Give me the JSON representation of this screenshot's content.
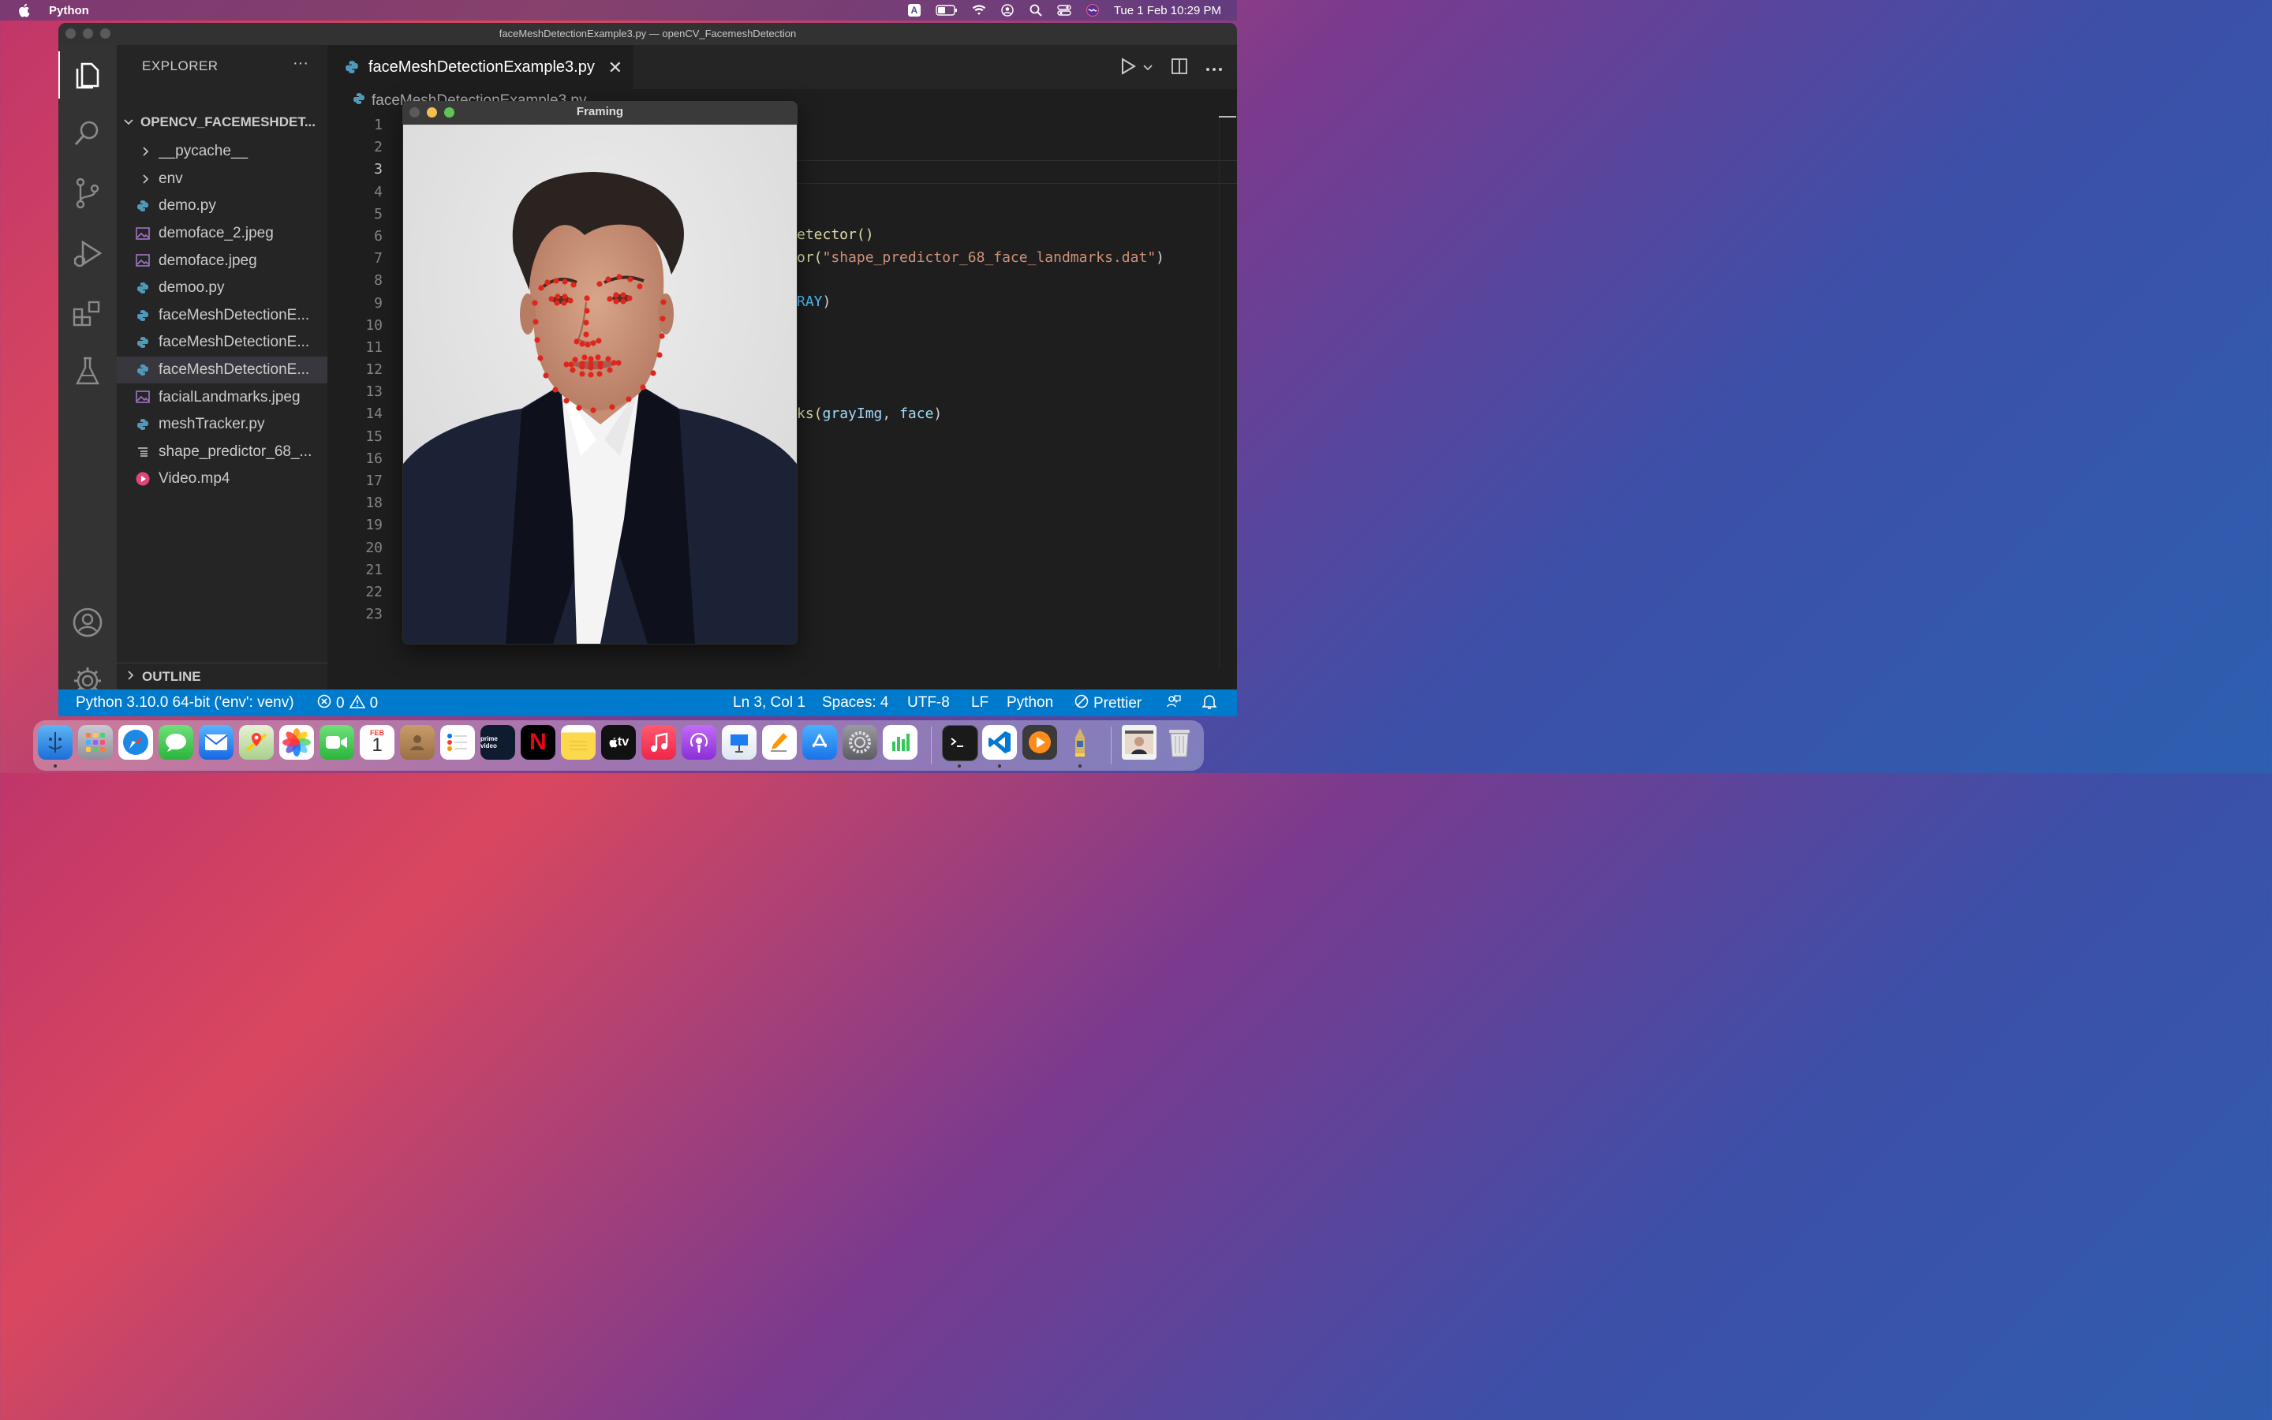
{
  "menubar": {
    "app_name": "Python",
    "clock": "Tue 1 Feb  10:29 PM",
    "input_indicator": "A"
  },
  "window": {
    "title": "faceMeshDetectionExample3.py — openCV_FacemeshDetection"
  },
  "sidebar": {
    "header": "EXPLORER",
    "more": "···",
    "folder": "OPENCV_FACEMESHDET...",
    "items": [
      {
        "label": "__pycache__",
        "icon": "chevron-right-icon"
      },
      {
        "label": "env",
        "icon": "chevron-right-icon"
      },
      {
        "label": "demo.py",
        "icon": "python-icon"
      },
      {
        "label": "demoface_2.jpeg",
        "icon": "image-icon"
      },
      {
        "label": "demoface.jpeg",
        "icon": "image-icon"
      },
      {
        "label": "demoo.py",
        "icon": "python-icon"
      },
      {
        "label": "faceMeshDetectionE...",
        "icon": "python-icon"
      },
      {
        "label": "faceMeshDetectionE...",
        "icon": "python-icon"
      },
      {
        "label": "faceMeshDetectionE...",
        "icon": "python-icon",
        "selected": true
      },
      {
        "label": "facialLandmarks.jpeg",
        "icon": "image-icon"
      },
      {
        "label": "meshTracker.py",
        "icon": "python-icon"
      },
      {
        "label": "shape_predictor_68_...",
        "icon": "text-file-icon"
      },
      {
        "label": "Video.mp4",
        "icon": "video-icon"
      }
    ],
    "outline": "OUTLINE"
  },
  "editor": {
    "tab_label": "faceMeshDetectionExample3.py",
    "breadcrumb": "faceMeshDetectionExample3.py",
    "current_line": 3,
    "line_numbers": [
      "1",
      "2",
      "3",
      "4",
      "5",
      "6",
      "7",
      "8",
      "9",
      "10",
      "11",
      "12",
      "13",
      "14",
      "15",
      "16",
      "17",
      "18",
      "19",
      "20",
      "21",
      "22",
      "23"
    ],
    "visible_code": {
      "line6": "etector()",
      "line7_pre": "or(",
      "line7_str": "\"shape_predictor_68_face_landmarks.dat\"",
      "line7_post": ")",
      "line9_const": "RAY",
      "line9_post": ")",
      "line14_pre": "ks(",
      "line14_arg1": "grayImg",
      "line14_sep": ", ",
      "line14_arg2": "face",
      "line14_post": ")"
    }
  },
  "framing_window": {
    "title": "Framing"
  },
  "statusbar": {
    "interpreter": "Python 3.10.0 64-bit ('env': venv)",
    "errors": "0",
    "warnings": "0",
    "cursor": "Ln 3, Col 1",
    "spaces": "Spaces: 4",
    "encoding": "UTF-8",
    "eol": "LF",
    "language": "Python",
    "prettier": "Prettier"
  },
  "dock": {
    "calendar_month": "FEB",
    "calendar_day": "1",
    "appletv": "tv",
    "prime": "prime video",
    "netflix": "N"
  },
  "colors": {
    "statusbar": "#007acc",
    "editor_bg": "#1e1e1e",
    "sidebar_bg": "#252526",
    "landmark": "#e0261c"
  }
}
